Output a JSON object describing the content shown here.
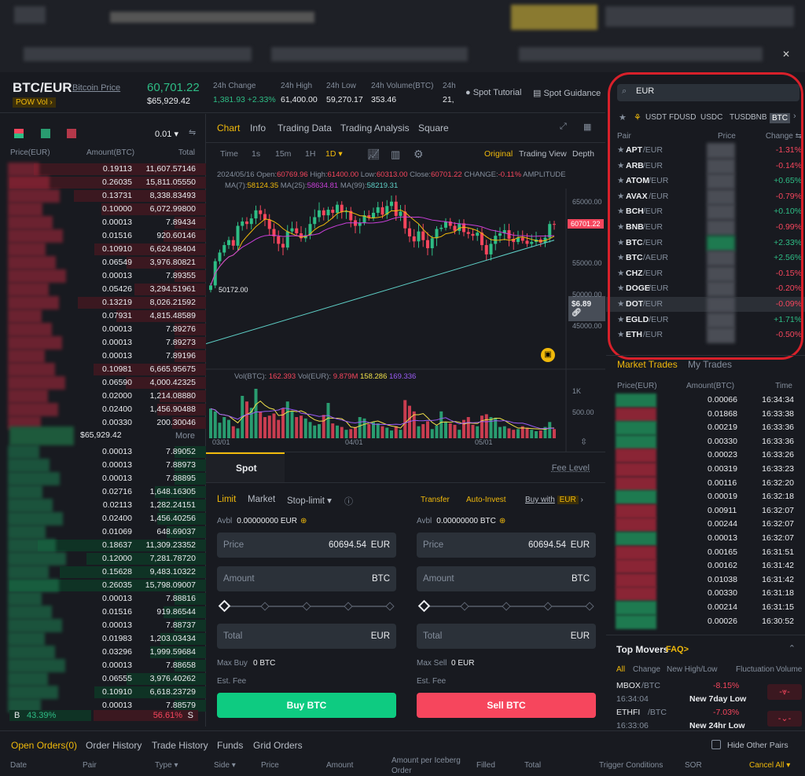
{
  "header": {
    "pair": "BTC/EUR",
    "pair_link": "Bitcoin Price",
    "tag_pow": "POW",
    "tag_vol": "Vol ›",
    "last_price": "60,701.22",
    "last_price_usd": "$65,929.42",
    "stats": [
      {
        "label": "24h Change",
        "value": "1,381.93 +2.33%"
      },
      {
        "label": "24h High",
        "value": "61,400.00"
      },
      {
        "label": "24h Low",
        "value": "59,270.17"
      },
      {
        "label": "24h Volume(BTC)",
        "value": "353.46"
      },
      {
        "label": "24h",
        "value": "21,"
      }
    ],
    "spot_tutorial": "Spot Tutorial",
    "spot_guidance": "Spot Guidance"
  },
  "orderbook": {
    "precision": "0.01",
    "headers": [
      "Price(EUR)",
      "Amount(BTC)",
      "Total"
    ],
    "asks": [
      [
        "0.19113",
        "11,607.57146"
      ],
      [
        "0.26035",
        "15,811.05550"
      ],
      [
        "0.13731",
        "8,338.83493"
      ],
      [
        "0.10000",
        "6,072.99800"
      ],
      [
        "0.00013",
        "7.89434"
      ],
      [
        "0.01516",
        "920.60146"
      ],
      [
        "0.10910",
        "6,624.98404"
      ],
      [
        "0.06549",
        "3,976.80821"
      ],
      [
        "0.00013",
        "7.89355"
      ],
      [
        "0.05426",
        "3,294.51961"
      ],
      [
        "0.13219",
        "8,026.21592"
      ],
      [
        "0.07931",
        "4,815.48589"
      ],
      [
        "0.00013",
        "7.89276"
      ],
      [
        "0.00013",
        "7.89273"
      ],
      [
        "0.00013",
        "7.89196"
      ],
      [
        "0.10981",
        "6,665.95675"
      ],
      [
        "0.06590",
        "4,000.42325"
      ],
      [
        "0.02000",
        "1,214.08880"
      ],
      [
        "0.02400",
        "1,456.90488"
      ],
      [
        "0.00330",
        "200.30046"
      ]
    ],
    "mid_usd": "$65,929.42",
    "more": "More",
    "bids": [
      [
        "0.00013",
        "7.89052"
      ],
      [
        "0.00013",
        "7.88973"
      ],
      [
        "0.00013",
        "7.88895"
      ],
      [
        "0.02716",
        "1,648.16305"
      ],
      [
        "0.02113",
        "1,282.24151"
      ],
      [
        "0.02400",
        "1,456.40256"
      ],
      [
        "0.01069",
        "648.69037"
      ],
      [
        "0.18637",
        "11,309.23352"
      ],
      [
        "0.12000",
        "7,281.78720"
      ],
      [
        "0.15628",
        "9,483.10322"
      ],
      [
        "0.26035",
        "15,798.09007"
      ],
      [
        "0.00013",
        "7.88816"
      ],
      [
        "0.01516",
        "919.86544"
      ],
      [
        "0.00013",
        "7.88737"
      ],
      [
        "0.01983",
        "1,203.03434"
      ],
      [
        "0.03296",
        "1,999.59684"
      ],
      [
        "0.00013",
        "7.88658"
      ],
      [
        "0.06555",
        "3,976.40262"
      ],
      [
        "0.10910",
        "6,618.23729"
      ],
      [
        "0.00013",
        "7.88579"
      ]
    ],
    "buy_label": "B",
    "buy_pct": "43.39%",
    "sell_pct": "56.61%",
    "sell_label": "S",
    "buy_ratio": 43.39
  },
  "chart": {
    "tabs": [
      "Chart",
      "Info",
      "Trading Data",
      "Trading Analysis",
      "Square"
    ],
    "intervals": [
      "Time",
      "1s",
      "15m",
      "1H",
      "1D ▾"
    ],
    "views": [
      "Original",
      "Trading View",
      "Depth"
    ],
    "info_date": "2024/05/16",
    "open_label": "Open:",
    "open": "60769.96",
    "high_label": "High:",
    "high": "61400.00",
    "low_label": "Low:",
    "low": "60313.00",
    "close_label": "Close:",
    "close": "60701.22",
    "change_label": "CHANGE:",
    "change": "-0.11%",
    "amplitude_label": "AMPLITUDE",
    "ma7_label": "MA(7):",
    "ma7": "58124.35",
    "ma25_label": "MA(25):",
    "ma25": "58634.81",
    "ma99_label": "MA(99):",
    "ma99": "58219.31",
    "vol_btc_label": "Vol(BTC):",
    "vol_btc": "162.393",
    "vol_eur_label": "Vol(EUR):",
    "vol_eur": "9.879M",
    "vol_ma1": "158.286",
    "vol_ma2": "169.336",
    "price_ticks": [
      "65000.00",
      "55000.00",
      "50000.00",
      "45000.00"
    ],
    "vol_ticks": [
      "1K",
      "500.00"
    ],
    "date_ticks": [
      "03/01",
      "04/01",
      "05/01"
    ],
    "last_tag": "60701.22",
    "low_marker": "50172.00",
    "usd_tag": "$6.89",
    "colors": {
      "up": "#2ebd85",
      "down": "#f6465d",
      "ma7": "#f0b90b",
      "ma25": "#c83fd8",
      "ma99": "#5fd1c8"
    }
  },
  "chart_data": {
    "type": "candlestick",
    "x_start": "03/01",
    "x_end": "05/16",
    "ylim": [
      40000,
      67000
    ],
    "closes": [
      50900,
      54800,
      56200,
      57400,
      58200,
      57300,
      60500,
      61200,
      60800,
      61700,
      63000,
      62400,
      61500,
      60000,
      58800,
      57600,
      57000,
      59600,
      60100,
      59300,
      58500,
      59000,
      60800,
      61900,
      63000,
      62200,
      63100,
      62600,
      63900,
      62700,
      62900,
      61400,
      60500,
      61000,
      62200,
      61800,
      62600,
      63500,
      62300,
      63700,
      64400,
      62100,
      62800,
      60100,
      58800,
      58000,
      59600,
      58200,
      56900,
      58500,
      60000,
      60200,
      61200,
      60500,
      59700,
      60900,
      59500,
      59200,
      58900,
      59400,
      57400,
      55900,
      57600,
      58900,
      59300,
      59800,
      58400,
      57900,
      58600,
      58100,
      57600,
      57900,
      58300,
      57800,
      58600,
      60800,
      60701
    ],
    "volumes": [
      420,
      380,
      220,
      300,
      260,
      170,
      140,
      600,
      520,
      430,
      700,
      380,
      300,
      320,
      350,
      260,
      420,
      520,
      380,
      300,
      320,
      280,
      230,
      180,
      200,
      330,
      500,
      210,
      180,
      160,
      120,
      130,
      160,
      300,
      280,
      200,
      230,
      210,
      170,
      150,
      110,
      170,
      120,
      540,
      460,
      380,
      170,
      200,
      240,
      130,
      180,
      380,
      230,
      210,
      190,
      120,
      260,
      300,
      190,
      170,
      320,
      340,
      300,
      290,
      160,
      170,
      140,
      120,
      130,
      170,
      150,
      120,
      100,
      110,
      160,
      230,
      130
    ]
  },
  "order_form": {
    "tab": "Spot",
    "fee_level": "Fee Level",
    "types": [
      "Limit",
      "Market",
      "Stop-limit ▾"
    ],
    "transfer": "Transfer",
    "auto_invest": "Auto-Invest",
    "buy_with": "Buy with",
    "buy_with_cur": "EUR",
    "buy": {
      "avbl_label": "Avbl",
      "avbl": "0.00000000 EUR",
      "price_label": "Price",
      "price": "60694.54",
      "price_cur": "EUR",
      "amount_label": "Amount",
      "amount_cur": "BTC",
      "total_label": "Total",
      "total_cur": "EUR",
      "max_label": "Max Buy",
      "max": "0 BTC",
      "fee_label": "Est. Fee",
      "button": "Buy BTC"
    },
    "sell": {
      "avbl_label": "Avbl",
      "avbl": "0.00000000 BTC",
      "price_label": "Price",
      "price": "60694.54",
      "price_cur": "EUR",
      "amount_label": "Amount",
      "amount_cur": "BTC",
      "total_label": "Total",
      "total_cur": "EUR",
      "max_label": "Max Sell",
      "max": "0 EUR",
      "fee_label": "Est. Fee",
      "button": "Sell BTC"
    }
  },
  "market": {
    "search_value": "EUR",
    "quote_tabs": [
      "USDT",
      "FDUSD",
      "USDC",
      "TUSD",
      "BNB",
      "BTC"
    ],
    "headers": [
      "Pair",
      "Price",
      "Change ⇆"
    ],
    "pairs": [
      [
        "APT",
        "/EUR",
        "-1.31%"
      ],
      [
        "ARB",
        "/EUR",
        "-0.14%"
      ],
      [
        "ATOM",
        "/EUR",
        "+0.65%"
      ],
      [
        "AVAX",
        "/EUR",
        "-0.79%"
      ],
      [
        "BCH",
        "/EUR",
        "+0.10%"
      ],
      [
        "BNB",
        "/EUR",
        "-0.99%"
      ],
      [
        "BTC",
        "/EUR",
        "+2.33%"
      ],
      [
        "BTC",
        "/AEUR",
        "+2.56%"
      ],
      [
        "CHZ",
        "/EUR",
        "-0.15%"
      ],
      [
        "DOGE",
        "/EUR",
        "-0.20%"
      ],
      [
        "DOT",
        "/EUR",
        "-0.09%"
      ],
      [
        "EGLD",
        "/EUR",
        "+1.71%"
      ],
      [
        "ETH",
        "/EUR",
        "-0.50%"
      ]
    ]
  },
  "trades": {
    "tabs": [
      "Market Trades",
      "My Trades"
    ],
    "headers": [
      "Price(EUR)",
      "Amount(BTC)",
      "Time"
    ],
    "rows": [
      [
        "0.00066",
        "16:34:34"
      ],
      [
        "0.01868",
        "16:33:38"
      ],
      [
        "0.00219",
        "16:33:36"
      ],
      [
        "0.00330",
        "16:33:36"
      ],
      [
        "0.00023",
        "16:33:26"
      ],
      [
        "0.00319",
        "16:33:23"
      ],
      [
        "0.00116",
        "16:32:20"
      ],
      [
        "0.00019",
        "16:32:18"
      ],
      [
        "0.00911",
        "16:32:07"
      ],
      [
        "0.00244",
        "16:32:07"
      ],
      [
        "0.00013",
        "16:32:07"
      ],
      [
        "0.00165",
        "16:31:51"
      ],
      [
        "0.00162",
        "16:31:42"
      ],
      [
        "0.01038",
        "16:31:42"
      ],
      [
        "0.00330",
        "16:31:18"
      ],
      [
        "0.00214",
        "16:31:15"
      ],
      [
        "0.00026",
        "16:30:52"
      ]
    ]
  },
  "movers": {
    "title": "Top Movers",
    "faq": "FAQ>",
    "tabs": [
      "All",
      "Change",
      "New High/Low",
      "Fluctuation",
      "Volume"
    ],
    "items": [
      {
        "base": "MBOX",
        "quote": "/BTC",
        "change": "-8.15%",
        "time": "16:34:04",
        "note": "New 7day Low"
      },
      {
        "base": "ETHFI",
        "quote": "/BTC",
        "change": "-7.03%",
        "time": "16:33:06",
        "note": "New 24hr Low"
      }
    ]
  },
  "orders": {
    "tabs": [
      "Open Orders(0)",
      "Order History",
      "Trade History",
      "Funds",
      "Grid Orders"
    ],
    "hide_other": "Hide Other Pairs",
    "columns": [
      "Date",
      "Pair",
      "Type ▾",
      "Side ▾",
      "Price",
      "Amount",
      "Amount per Iceberg Order",
      "Filled",
      "Total",
      "Trigger Conditions",
      "SOR"
    ],
    "cancel_all": "Cancel All ▾"
  }
}
